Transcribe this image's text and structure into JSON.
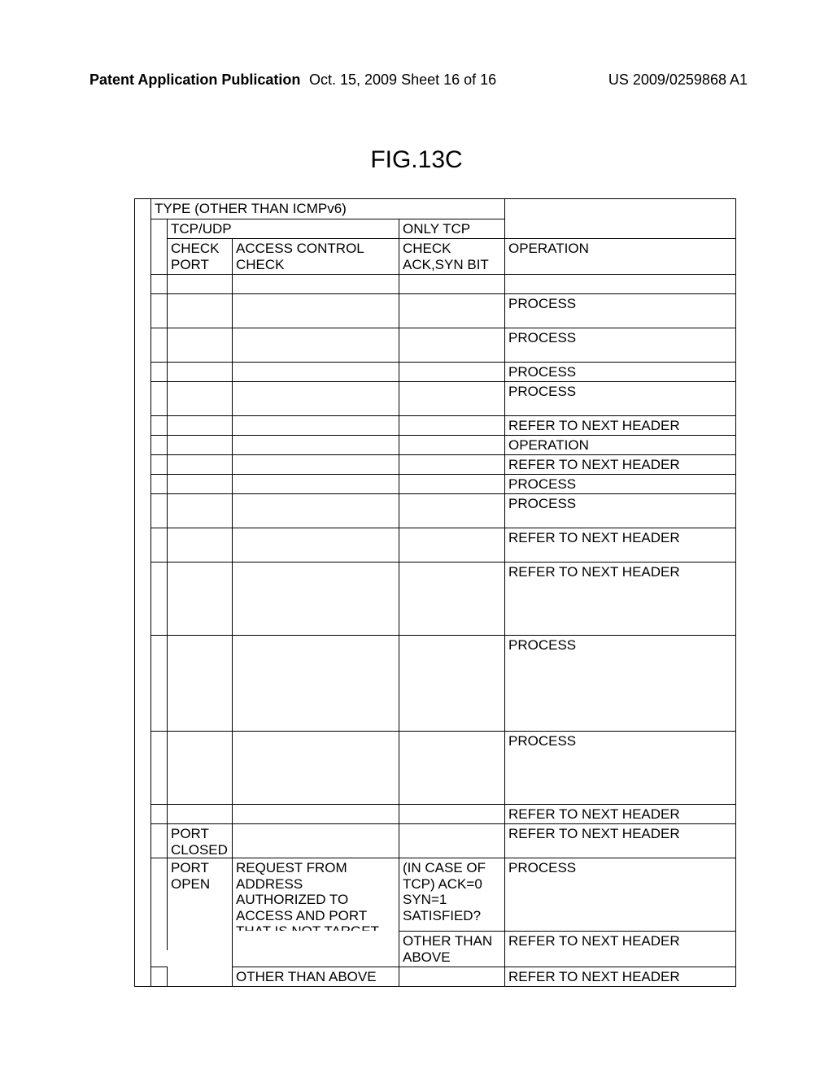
{
  "header": {
    "left": "Patent Application Publication",
    "center": "Oct. 15, 2009   Sheet 16 of 16",
    "right": "US 2009/0259868 A1"
  },
  "figure_label": "FIG.13C",
  "table": {
    "h1": "TYPE (OTHER THAN ICMPv6)",
    "h2a": "TCP/UDP",
    "h2b": "ONLY TCP",
    "h3a": "CHECK PORT",
    "h3b": "ACCESS CONTROL CHECK",
    "h3c": "CHECK ACK,SYN BIT",
    "h3d": "OPERATION",
    "rows": [
      {
        "port": "",
        "acc": "",
        "tcp": "",
        "op": "",
        "tall": 0
      },
      {
        "port": "",
        "acc": "",
        "tcp": "",
        "op": "PROCESS",
        "tall": 1
      },
      {
        "port": "",
        "acc": "",
        "tcp": "",
        "op": "PROCESS",
        "tall": 1
      },
      {
        "port": "",
        "acc": "",
        "tcp": "",
        "op": "PROCESS",
        "tall": 0
      },
      {
        "port": "",
        "acc": "",
        "tcp": "",
        "op": "PROCESS",
        "tall": 1
      },
      {
        "port": "",
        "acc": "",
        "tcp": "",
        "op": "REFER TO NEXT HEADER",
        "tall": 0
      },
      {
        "port": "",
        "acc": "",
        "tcp": "",
        "op": "OPERATION",
        "tall": 0
      },
      {
        "port": "",
        "acc": "",
        "tcp": "",
        "op": "REFER TO NEXT HEADER",
        "tall": 0
      },
      {
        "port": "",
        "acc": "",
        "tcp": "",
        "op": "PROCESS",
        "tall": 0
      },
      {
        "port": "",
        "acc": "",
        "tcp": "",
        "op": "PROCESS",
        "tall": 1
      },
      {
        "port": "",
        "acc": "",
        "tcp": "",
        "op": "REFER TO NEXT HEADER",
        "tall": 1
      },
      {
        "port": "",
        "acc": "",
        "tcp": "",
        "op": "REFER TO NEXT HEADER",
        "tall": 3
      },
      {
        "port": "",
        "acc": "",
        "tcp": "",
        "op": "PROCESS",
        "tall": 4
      },
      {
        "port": "",
        "acc": "",
        "tcp": "",
        "op": "PROCESS",
        "tall": 3
      },
      {
        "port": "",
        "acc": "",
        "tcp": "",
        "op": "REFER TO NEXT HEADER",
        "tall": 0
      },
      {
        "port": "PORT CLOSED",
        "acc": "",
        "tcp": "",
        "op": "REFER TO NEXT HEADER",
        "tall": 1
      },
      {
        "port": "PORT OPEN",
        "acc": "REQUEST FROM ADDRESS AUTHORIZED TO ACCESS AND PORT THAT IS NOT TARGET OF ACCESS CONTROL",
        "tcp": "(IN CASE OF TCP) ACK=0 SYN=1 SATISFIED?",
        "op": "PROCESS",
        "tall": 3,
        "split": 1,
        "acc2": "",
        "tcp2": "OTHER THAN ABOVE",
        "op2": "REFER TO NEXT HEADER"
      },
      {
        "port": "",
        "acc": "OTHER THAN ABOVE",
        "tcp": "",
        "op": "REFER TO NEXT HEADER",
        "tall": 0,
        "portcont": 1
      }
    ]
  }
}
